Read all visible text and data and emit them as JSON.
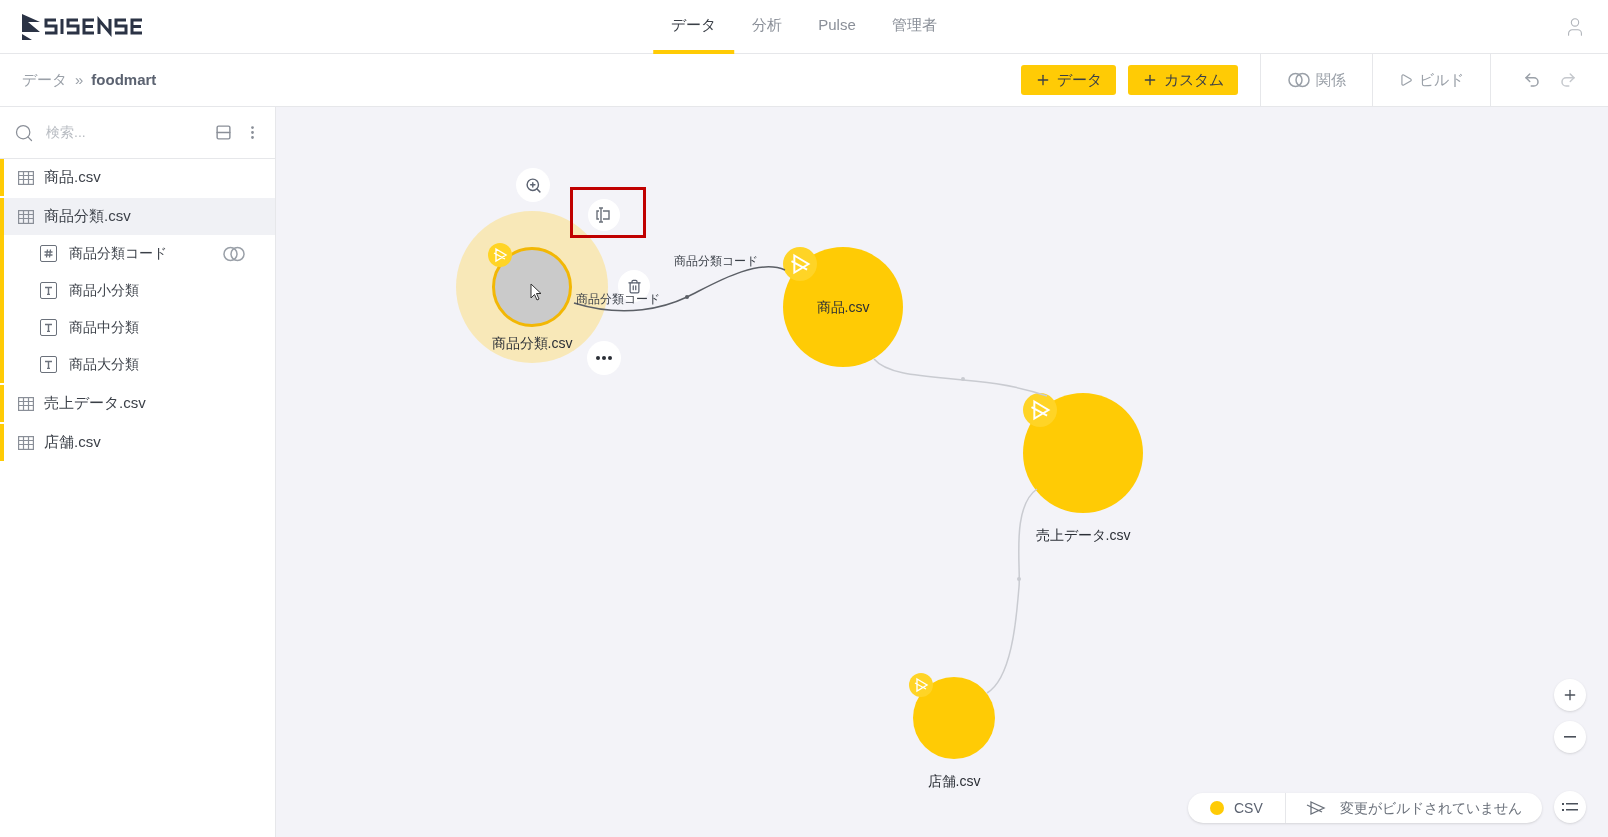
{
  "header": {
    "tabs": [
      {
        "label": "データ",
        "selected": true
      },
      {
        "label": "分析",
        "selected": false
      },
      {
        "label": "Pulse",
        "selected": false
      },
      {
        "label": "管理者",
        "selected": false
      }
    ]
  },
  "breadcrumb": {
    "items": [
      "データ",
      "foodmart"
    ],
    "separator": "»"
  },
  "toolbar": {
    "buttons": [
      {
        "label": "データ",
        "kind": "primary"
      },
      {
        "label": "カスタム",
        "kind": "primary"
      },
      {
        "label": "関係",
        "kind": "relation"
      },
      {
        "label": "ビルド",
        "kind": "build"
      }
    ]
  },
  "sidebar": {
    "search": {
      "placeholder": "検索..."
    },
    "tables": [
      {
        "name": "商品.csv",
        "selected": false
      },
      {
        "name": "商品分類.csv",
        "selected": true,
        "children": [
          {
            "name": "商品分類コード",
            "kind": "number",
            "linked": true
          },
          {
            "name": "商品小分類",
            "kind": "text",
            "linked": false
          },
          {
            "name": "商品中分類",
            "kind": "text",
            "linked": false
          },
          {
            "name": "商品大分類",
            "kind": "text",
            "linked": false
          }
        ]
      },
      {
        "name": "売上データ.csv",
        "selected": false
      },
      {
        "name": "店舗.csv",
        "selected": false
      }
    ]
  },
  "canvas": {
    "nodes": [
      {
        "label": "商品分類.csv",
        "selected": true,
        "label_inside": false
      },
      {
        "label": "商品.csv",
        "selected": false,
        "label_inside": true
      },
      {
        "label": "売上データ.csv",
        "selected": false,
        "label_inside": false
      },
      {
        "label": "店舗.csv",
        "selected": false,
        "label_inside": false
      }
    ],
    "edges": [
      {
        "labels": [
          "商品分類コード",
          "商品分類コード"
        ],
        "active": true
      },
      {
        "active": false
      },
      {
        "active": false
      }
    ],
    "legend": {
      "type": "CSV",
      "status": "変更がビルドされていません"
    }
  }
}
